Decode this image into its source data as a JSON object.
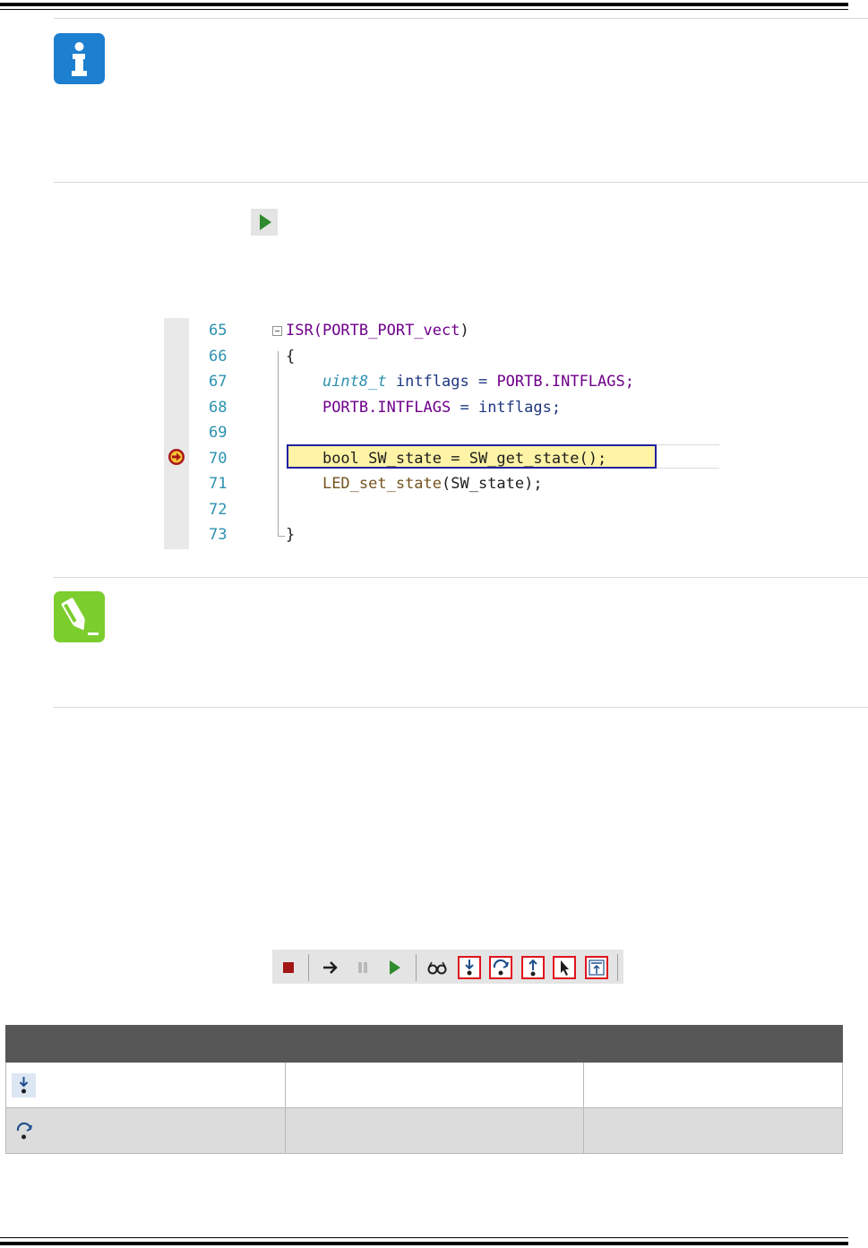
{
  "code_editor": {
    "lines": [
      {
        "num": "65",
        "segments": [
          {
            "t": "ISR(",
            "c": "macro"
          },
          {
            "t": "PORTB_PORT_vect",
            "c": "macro"
          },
          {
            "t": ")",
            "c": "plain"
          }
        ]
      },
      {
        "num": "66",
        "segments": [
          {
            "t": "{",
            "c": "plain"
          }
        ]
      },
      {
        "num": "67",
        "segments": [
          {
            "t": "    ",
            "c": "plain"
          },
          {
            "t": "uint8_t",
            "c": "type"
          },
          {
            "t": " intflags = ",
            "c": "ident"
          },
          {
            "t": "PORTB",
            "c": "macro"
          },
          {
            "t": ".INTFLAGS;",
            "c": "macro"
          }
        ]
      },
      {
        "num": "68",
        "segments": [
          {
            "t": "    ",
            "c": "plain"
          },
          {
            "t": "PORTB.INTFLAGS",
            "c": "macro"
          },
          {
            "t": " = intflags;",
            "c": "ident"
          }
        ]
      },
      {
        "num": "69",
        "segments": []
      },
      {
        "num": "70",
        "segments": [
          {
            "t": "    ",
            "c": "plain"
          },
          {
            "t": "bool SW_state = SW_get_state();",
            "c": "plain"
          }
        ]
      },
      {
        "num": "71",
        "segments": [
          {
            "t": "    ",
            "c": "plain"
          },
          {
            "t": "LED_set_state",
            "c": "fn"
          },
          {
            "t": "(SW_state);",
            "c": "plain"
          }
        ]
      },
      {
        "num": "72",
        "segments": []
      },
      {
        "num": "73",
        "segments": [
          {
            "t": "}",
            "c": "plain"
          }
        ]
      }
    ],
    "current_line": "70"
  },
  "toolbar": {
    "buttons": [
      {
        "name": "stop-debugging-button",
        "icon": "stop-square-icon",
        "highlighted": false
      },
      {
        "name": "show-next-statement-button",
        "icon": "arrow-right-icon",
        "highlighted": false
      },
      {
        "name": "break-all-button",
        "icon": "pause-icon",
        "highlighted": false
      },
      {
        "name": "continue-button",
        "icon": "play-icon",
        "highlighted": false
      },
      {
        "name": "quick-watch-button",
        "icon": "glasses-icon",
        "highlighted": false
      },
      {
        "name": "step-into-button",
        "icon": "step-into-icon",
        "highlighted": true
      },
      {
        "name": "step-over-button",
        "icon": "step-over-icon",
        "highlighted": true
      },
      {
        "name": "step-out-button",
        "icon": "step-out-icon",
        "highlighted": true
      },
      {
        "name": "run-to-cursor-button",
        "icon": "cursor-arrow-icon",
        "highlighted": true
      },
      {
        "name": "reset-button",
        "icon": "reset-icon",
        "highlighted": true
      }
    ]
  },
  "table": {
    "rows": [
      {
        "icon": "step-into-icon"
      },
      {
        "icon": "step-over-icon"
      }
    ]
  },
  "colors": {
    "info_icon": "#1c7fd0",
    "note_icon": "#7ccd2e",
    "highlight_line": "#fff3a5",
    "table_header": "#575757"
  }
}
